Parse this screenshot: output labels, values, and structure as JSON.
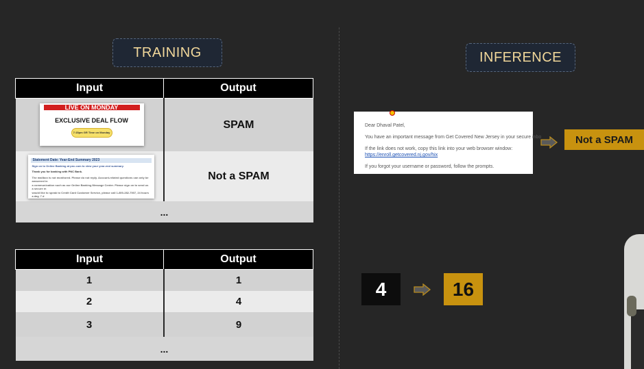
{
  "training_label": "TRAINING",
  "inference_label": "INFERENCE",
  "table1": {
    "headers": [
      "Input",
      "Output"
    ],
    "rows": [
      {
        "output": "SPAM"
      },
      {
        "output": "Not a SPAM"
      }
    ],
    "ellipsis": "..."
  },
  "thumb_spam": {
    "banner": "LIVE ON MONDAY",
    "title": "EXCLUSIVE DEAL FLOW",
    "button": "7:15pm GR Time on Monday"
  },
  "thumb_bank": {
    "header": "Statement Date: Year-End Summary 2023",
    "line1": "Sign on to Online Banking at pnc.com to view your year-end summary.",
    "line2": "Thank you for banking with PNC Bank.",
    "line3": "The mailbox is not monitored. Please do not reply. Account-related questions can only be answered in",
    "line4": "a communication such as our Online Banking Message Center. Please sign on to send us a secure m",
    "line5": "would like to speak to Credit Card Customer Service, please call 1-800-282-7007, 24 hours a day, 7 d"
  },
  "table2": {
    "headers": [
      "Input",
      "Output"
    ],
    "rows": [
      {
        "input": "1",
        "output": "1"
      },
      {
        "input": "2",
        "output": "4"
      },
      {
        "input": "3",
        "output": "9"
      }
    ],
    "ellipsis": "..."
  },
  "email": {
    "greeting": "Dear Dhaval Patel,",
    "line1": "You have an important message from Get Covered New Jersey in your secure inbo",
    "line2": "If the link does not work, copy this link into your web browser window:",
    "link": "https://enroll.getcovered.nj.gov/hix",
    "line3": "If you forgot your username or password, follow the prompts."
  },
  "inference_output": "Not a SPAM",
  "inference_input_number": "4",
  "inference_output_number": "16",
  "colors": {
    "background": "#262626",
    "gold": "#c8920f",
    "badge_text": "#f1d79a"
  }
}
